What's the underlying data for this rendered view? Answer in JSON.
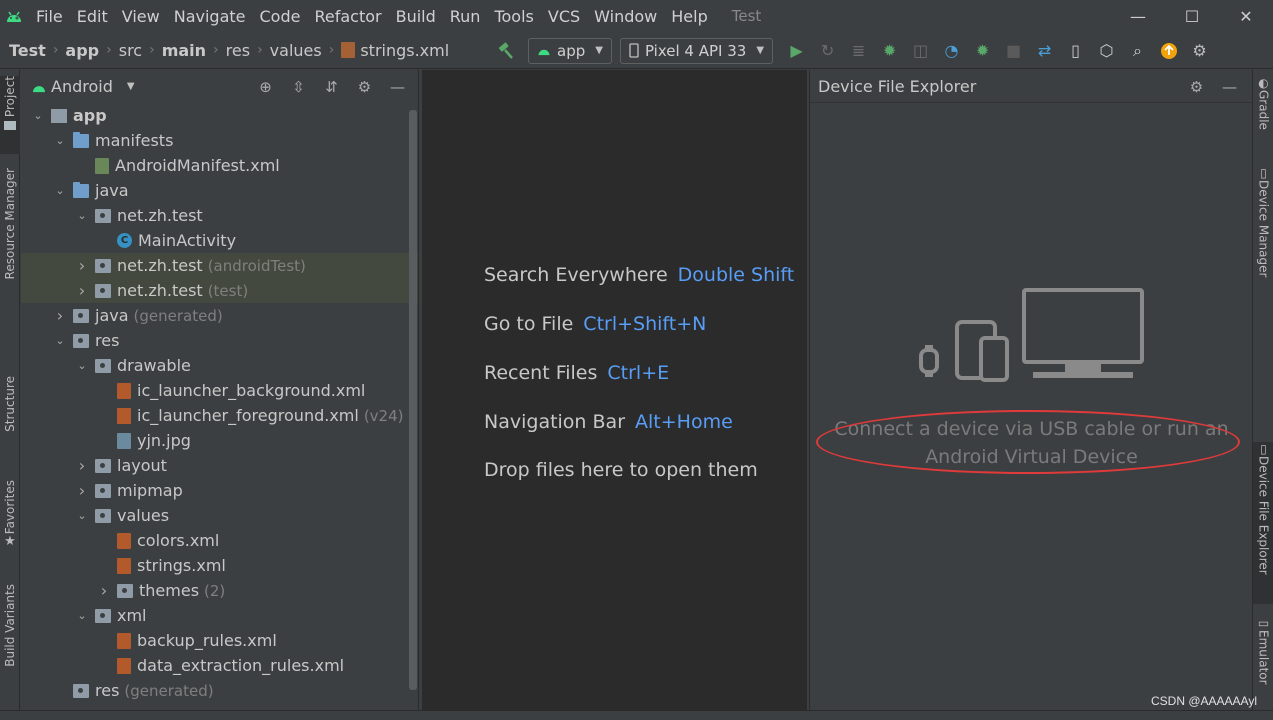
{
  "menubar": {
    "items": [
      "File",
      "Edit",
      "View",
      "Navigate",
      "Code",
      "Refactor",
      "Build",
      "Run",
      "Tools",
      "VCS",
      "Window",
      "Help"
    ],
    "window_title": "Test",
    "controls": {
      "minimize": "—",
      "maximize": "☐",
      "close": "✕"
    }
  },
  "breadcrumb": {
    "items": [
      "Test",
      "app",
      "src",
      "main",
      "res",
      "values",
      "strings.xml"
    ]
  },
  "toolbar": {
    "config_label": "app",
    "device_label": "Pixel 4 API 33"
  },
  "left_strip": {
    "tabs": [
      "Project",
      "Resource Manager",
      "Structure",
      "Favorites",
      "Build Variants"
    ]
  },
  "project_panel": {
    "view_label": "Android",
    "tree": [
      {
        "label": "app",
        "depth": 0,
        "arrow": "down",
        "icon": "mod",
        "bold": true,
        "suffix": "",
        "hl": false
      },
      {
        "label": "manifests",
        "depth": 1,
        "arrow": "down",
        "icon": "folder",
        "suffix": "",
        "hl": false
      },
      {
        "label": "AndroidManifest.xml",
        "depth": 2,
        "arrow": "none",
        "icon": "mf",
        "suffix": "",
        "hl": false
      },
      {
        "label": "java",
        "depth": 1,
        "arrow": "down",
        "icon": "folder",
        "suffix": "",
        "hl": false
      },
      {
        "label": "net.zh.test",
        "depth": 2,
        "arrow": "down",
        "icon": "pkg",
        "suffix": "",
        "hl": false
      },
      {
        "label": "MainActivity",
        "depth": 3,
        "arrow": "none",
        "icon": "cls",
        "suffix": "",
        "hl": false
      },
      {
        "label": "net.zh.test",
        "depth": 2,
        "arrow": "right",
        "icon": "pkg",
        "suffix": "(androidTest)",
        "hl": true
      },
      {
        "label": "net.zh.test",
        "depth": 2,
        "arrow": "right",
        "icon": "pkg",
        "suffix": "(test)",
        "hl": true
      },
      {
        "label": "java",
        "depth": 1,
        "arrow": "right",
        "icon": "pkg",
        "suffix": "(generated)",
        "hl": false
      },
      {
        "label": "res",
        "depth": 1,
        "arrow": "down",
        "icon": "pkg",
        "suffix": "",
        "hl": false
      },
      {
        "label": "drawable",
        "depth": 2,
        "arrow": "down",
        "icon": "pkg",
        "suffix": "",
        "hl": false
      },
      {
        "label": "ic_launcher_background.xml",
        "depth": 3,
        "arrow": "none",
        "icon": "xml",
        "suffix": "",
        "hl": false
      },
      {
        "label": "ic_launcher_foreground.xml",
        "depth": 3,
        "arrow": "none",
        "icon": "xml",
        "suffix": "(v24)",
        "hl": false
      },
      {
        "label": "yjn.jpg",
        "depth": 3,
        "arrow": "none",
        "icon": "img",
        "suffix": "",
        "hl": false
      },
      {
        "label": "layout",
        "depth": 2,
        "arrow": "right",
        "icon": "pkg",
        "suffix": "",
        "hl": false
      },
      {
        "label": "mipmap",
        "depth": 2,
        "arrow": "right",
        "icon": "pkg",
        "suffix": "",
        "hl": false
      },
      {
        "label": "values",
        "depth": 2,
        "arrow": "down",
        "icon": "pkg",
        "suffix": "",
        "hl": false
      },
      {
        "label": "colors.xml",
        "depth": 3,
        "arrow": "none",
        "icon": "xml",
        "suffix": "",
        "hl": false
      },
      {
        "label": "strings.xml",
        "depth": 3,
        "arrow": "none",
        "icon": "xml",
        "suffix": "",
        "hl": false
      },
      {
        "label": "themes",
        "depth": 3,
        "arrow": "right",
        "icon": "pkg",
        "suffix": "(2)",
        "hl": false
      },
      {
        "label": "xml",
        "depth": 2,
        "arrow": "down",
        "icon": "pkg",
        "suffix": "",
        "hl": false
      },
      {
        "label": "backup_rules.xml",
        "depth": 3,
        "arrow": "none",
        "icon": "xml",
        "suffix": "",
        "hl": false
      },
      {
        "label": "data_extraction_rules.xml",
        "depth": 3,
        "arrow": "none",
        "icon": "xml",
        "suffix": "",
        "hl": false
      },
      {
        "label": "res",
        "depth": 1,
        "arrow": "none",
        "icon": "pkg",
        "suffix": "(generated)",
        "hl": false
      }
    ]
  },
  "editor": {
    "hints": [
      {
        "action": "Search Everywhere",
        "shortcut": "Double Shift"
      },
      {
        "action": "Go to File",
        "shortcut": "Ctrl+Shift+N"
      },
      {
        "action": "Recent Files",
        "shortcut": "Ctrl+E"
      },
      {
        "action": "Navigation Bar",
        "shortcut": "Alt+Home"
      },
      {
        "action": "Drop files here to open them",
        "shortcut": ""
      }
    ]
  },
  "device_file_explorer": {
    "title": "Device File Explorer",
    "message_line1": "Connect a device via USB cable or run an",
    "message_line2": "Android Virtual Device"
  },
  "right_strip": {
    "tabs": [
      "Gradle",
      "Device Manager",
      "Device File Explorer",
      "Emulator"
    ]
  },
  "watermark": "CSDN @AAAAAAyl",
  "colors": {
    "accent_blue": "#589df6",
    "highlight_green": "#43493e",
    "annotation_red": "#e03a3a"
  }
}
